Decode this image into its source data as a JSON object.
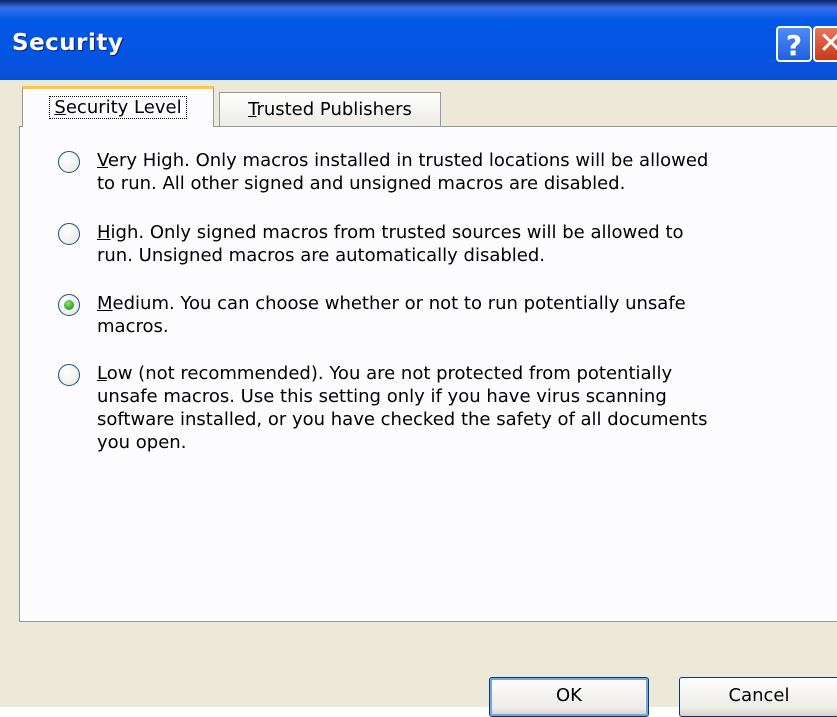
{
  "window": {
    "title": "Security",
    "help_button": "?",
    "close_button": "✕"
  },
  "tabs": [
    {
      "label": "Security Level",
      "active": true,
      "accel_index": 0
    },
    {
      "label": "Trusted Publishers",
      "active": false,
      "accel_index": 0
    }
  ],
  "options": [
    {
      "accel": "V",
      "text": "ery High. Only macros installed in trusted locations will be allowed\nto run. All other signed and unsigned macros are disabled.",
      "checked": false
    },
    {
      "accel": "H",
      "text": "igh. Only signed macros from trusted sources will be allowed to\nrun. Unsigned macros are automatically disabled.",
      "checked": false
    },
    {
      "accel": "M",
      "text": "edium. You can choose whether or not to run potentially unsafe\nmacros.",
      "checked": true
    },
    {
      "accel": "L",
      "text": "ow (not recommended). You are not protected from potentially\nunsafe macros. Use this setting only if you have virus scanning\nsoftware installed, or you have checked the safety of all documents\nyou open.",
      "checked": false
    }
  ],
  "buttons": {
    "ok_label": "OK",
    "cancel_label": "Cancel"
  },
  "colors": {
    "titlebar": "#0454e0",
    "tab_highlight": "#ffc83c",
    "radio_selected": "#3ea82a",
    "close": "#c8381b"
  }
}
